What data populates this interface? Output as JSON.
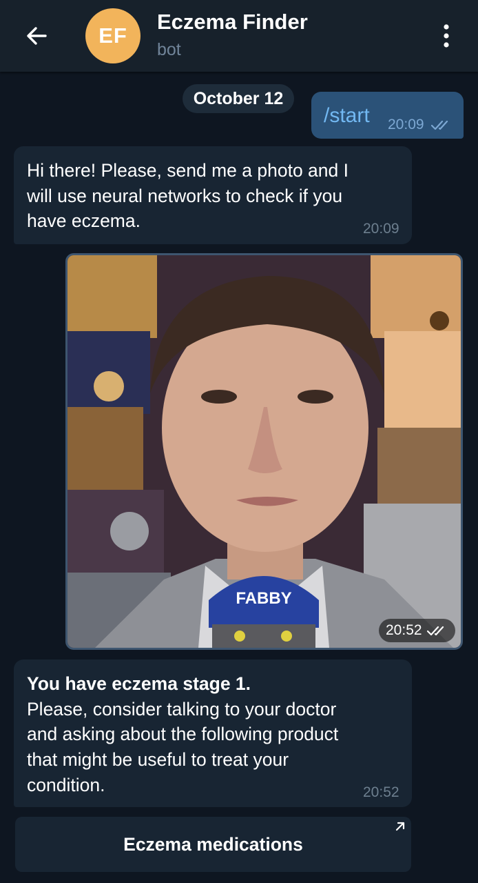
{
  "header": {
    "title": "Eczema Finder",
    "subtitle": "bot",
    "avatar_initials": "EF",
    "avatar_color": "#f2b45b",
    "back_icon": "arrow-left-icon",
    "menu_icon": "more-vertical-icon"
  },
  "chat": {
    "date_label": "October 12",
    "messages": [
      {
        "from": "user",
        "text": "/start",
        "time": "20:09",
        "status": "read"
      },
      {
        "from": "bot",
        "lines": [
          "Hi there! Please, send me a photo and I",
          "will use neural networks to check if you",
          "have eczema."
        ],
        "time": "20:09"
      },
      {
        "from": "user",
        "type": "photo",
        "caption": "FABBY",
        "time": "20:52",
        "status": "read"
      },
      {
        "from": "bot",
        "bold_line": "You have eczema stage 1.",
        "lines": [
          "Please, consider talking to your doctor",
          "and asking about the following product",
          "that might be useful to treat your",
          "condition."
        ],
        "time": "20:52"
      }
    ],
    "inline_button": {
      "label": "Eczema medications",
      "icon": "external-link-arrow-icon"
    }
  },
  "colors": {
    "background": "#0e1621",
    "header": "#17212b",
    "incoming_bubble": "#182533",
    "outgoing_bubble": "#2b5278",
    "accent": "#72b8f2"
  }
}
